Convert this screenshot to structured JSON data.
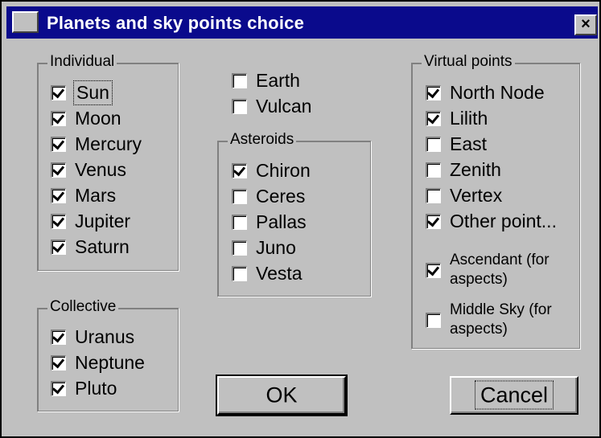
{
  "window": {
    "title": "Planets and sky points choice",
    "close_glyph": "×"
  },
  "individual": {
    "legend": "Individual",
    "items": [
      {
        "label": "Sun",
        "checked": true
      },
      {
        "label": "Moon",
        "checked": true
      },
      {
        "label": "Mercury",
        "checked": true
      },
      {
        "label": "Venus",
        "checked": true
      },
      {
        "label": "Mars",
        "checked": true
      },
      {
        "label": "Jupiter",
        "checked": true
      },
      {
        "label": "Saturn",
        "checked": true
      }
    ]
  },
  "collective": {
    "legend": "Collective",
    "items": [
      {
        "label": "Uranus",
        "checked": true
      },
      {
        "label": "Neptune",
        "checked": true
      },
      {
        "label": "Pluto",
        "checked": true
      }
    ]
  },
  "extra": {
    "items": [
      {
        "label": "Earth",
        "checked": false
      },
      {
        "label": "Vulcan",
        "checked": false
      }
    ]
  },
  "asteroids": {
    "legend": "Asteroids",
    "items": [
      {
        "label": "Chiron",
        "checked": true
      },
      {
        "label": "Ceres",
        "checked": false
      },
      {
        "label": "Pallas",
        "checked": false
      },
      {
        "label": "Juno",
        "checked": false
      },
      {
        "label": "Vesta",
        "checked": false
      }
    ]
  },
  "virtual": {
    "legend": "Virtual points",
    "items": [
      {
        "label": "North Node",
        "checked": true
      },
      {
        "label": "Lilith",
        "checked": true
      },
      {
        "label": "East",
        "checked": false
      },
      {
        "label": "Zenith",
        "checked": false
      },
      {
        "label": "Vertex",
        "checked": false
      },
      {
        "label": "Other point...",
        "checked": true
      }
    ],
    "ascendant": {
      "line1": "Ascendant (for",
      "line2": "aspects)",
      "checked": true
    },
    "middle_sky": {
      "line1": "Middle Sky (for",
      "line2": "aspects)",
      "checked": false
    }
  },
  "buttons": {
    "ok": "OK",
    "cancel": "Cancel"
  }
}
